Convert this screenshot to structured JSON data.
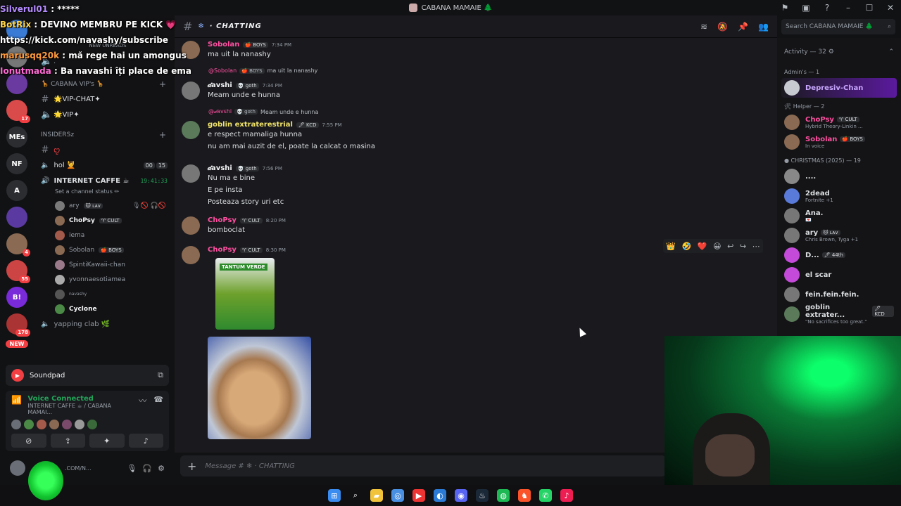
{
  "window": {
    "title": "CABANA MAMAIE 🌲",
    "controls": [
      "inbox-icon",
      "window-icon",
      "help-icon",
      "minimize-icon",
      "maximize-icon",
      "close-icon"
    ]
  },
  "overlay": {
    "lines": [
      {
        "user": "Silverul01",
        "text": " : *****"
      },
      {
        "user": "BotRix",
        "text": " : DEVINO MEMBRU PE KICK 💗"
      },
      {
        "user": "",
        "text": "https://kick.com/navashy/subscribe"
      },
      {
        "user": "marusqq20k",
        "text": " : mă rege hai un amongus"
      },
      {
        "user": "Ionutmada",
        "text": " : Ba navashi îți place de ema"
      }
    ]
  },
  "rail": {
    "servers": [
      {
        "label": "",
        "badge": ""
      },
      {
        "label": "",
        "badge": ""
      },
      {
        "label": "",
        "badge": ""
      },
      {
        "label": "",
        "badge": "17"
      },
      {
        "label": "MEs",
        "badge": ""
      },
      {
        "label": "NF",
        "badge": ""
      },
      {
        "label": "A",
        "badge": ""
      },
      {
        "label": "",
        "badge": ""
      },
      {
        "label": "",
        "badge": "4"
      },
      {
        "label": "",
        "badge": "55"
      },
      {
        "label": "B!",
        "badge": ""
      },
      {
        "label": "",
        "badge": "178"
      }
    ],
    "new_badge": "NEW"
  },
  "sidebar": {
    "new_unreads": "NEW UNREADS",
    "cat_vip": "🦒 CABANA VIP's 🦒",
    "vip_chat": "🌟VIP-CHAT✦",
    "vip_voice": "🌟VIP✦",
    "cat_insiders": "INSIDERSz",
    "insiders_text": "ꨄ",
    "hol": "hol 💆",
    "internet_caffe": {
      "name": "INTERNET CAFFE ☕",
      "timer": "19:41:33",
      "counts": [
        "00",
        "15"
      ],
      "status": "Set a channel status ✏"
    },
    "voice_users": [
      {
        "name": "ary",
        "tag": "🐱 ʟᴀᴠ",
        "highlight": false,
        "icons": "🎙🚫 🎧🚫"
      },
      {
        "name": "ChoPsy",
        "tag": "♈ CULT",
        "highlight": true,
        "icons": ""
      },
      {
        "name": "iema",
        "tag": "",
        "highlight": false,
        "icons": ""
      },
      {
        "name": "Sobolan",
        "tag": "🍎 BOYS",
        "highlight": false,
        "icons": ""
      },
      {
        "name": "SpintiKawaii-chan",
        "tag": "",
        "highlight": false,
        "icons": ""
      },
      {
        "name": "yvonnaesotiamea",
        "tag": "",
        "highlight": false,
        "icons": ""
      },
      {
        "name": "navashy",
        "tag": "",
        "highlight": false,
        "icons": ""
      },
      {
        "name": "Cyclone",
        "tag": "",
        "highlight": true,
        "icons": ""
      }
    ],
    "yapping": "yapping clab 🌿"
  },
  "soundpad": {
    "label": "Soundpad"
  },
  "voice_panel": {
    "status": "Voice Connected",
    "location": "INTERNET CAFFE ☕ / CABANA MAMAI..."
  },
  "userbar": {
    "handle": ".COM/N..."
  },
  "channel": {
    "name": "· CHATTING",
    "search_placeholder": "Search CABANA MAMAIE 🌲",
    "message_placeholder": "Message # ❄ · CHATTING"
  },
  "messages": [
    {
      "author": "Sobolan",
      "color": "#ff4fa1",
      "tag": "🍎 BOYS",
      "time": "7:34 PM",
      "lines": [
        "ma uit la nanashy"
      ],
      "reply": null
    },
    {
      "author": "𝒹avshi",
      "color": "#f2f3f5",
      "tag": "💀 goth",
      "time": "7:34 PM",
      "lines": [
        "Meam unde e hunna"
      ],
      "reply": {
        "name": "@Sobolan",
        "tag": "🍎 BOYS",
        "text": "ma uit la nanashy"
      }
    },
    {
      "author": "goblin extraterestrial",
      "color": "#f0e36a",
      "tag": "🖊 KCD",
      "time": "7:55 PM",
      "lines": [
        "e respect mamaliga hunna",
        "nu am mai auzit de el, poate la calcat o masina"
      ],
      "reply": {
        "name": "@𝒹avshi",
        "tag": "💀 goth",
        "text": "Meam unde e hunna"
      }
    },
    {
      "author": "𝒹avshi",
      "color": "#f2f3f5",
      "tag": "💀 goth",
      "time": "7:56 PM",
      "lines": [
        "Nu ma e bine",
        "E pe insta",
        "Posteaza story uri etc"
      ],
      "reply": null
    },
    {
      "author": "ChoPsy",
      "color": "#ff4fa1",
      "tag": "♈ CULT",
      "time": "8:20 PM",
      "lines": [
        "bomboclat"
      ],
      "reply": null
    },
    {
      "author": "ChoPsy",
      "color": "#ff4fa1",
      "tag": "♈ CULT",
      "time": "8:30 PM",
      "lines": [],
      "reply": null
    }
  ],
  "image_label": "TANTUM VERDE",
  "reactions": [
    "👑",
    "🤣",
    "❤️",
    "😀",
    "↩",
    "↪",
    "⋯"
  ],
  "members": {
    "activity": "Activity — 32 ⚙",
    "groups": [
      {
        "label": "Admin's — 1",
        "items": [
          {
            "name": "Depresiv-Chan",
            "sub": "",
            "color": "#c9a7ff",
            "tag": "",
            "highlight": true
          }
        ]
      },
      {
        "label": "🛠 Helper — 2",
        "items": [
          {
            "name": "ChoPsy",
            "sub": "Hybrid Theory-Linkin ...",
            "color": "#ff4fa1",
            "tag": "♈ CULT",
            "highlight": false
          },
          {
            "name": "Sobolan",
            "sub": "In voice",
            "color": "#ff4fa1",
            "tag": "🍎 BOYS",
            "highlight": false
          }
        ]
      },
      {
        "label": "● CHRISTMAS (2025) — 19",
        "items": [
          {
            "name": "....",
            "sub": "",
            "color": "#dbdee1",
            "tag": "",
            "highlight": false
          },
          {
            "name": "2dead",
            "sub": "Fortnite +1",
            "color": "#dbdee1",
            "tag": "",
            "highlight": false
          },
          {
            "name": "Ana.",
            "sub": "💌",
            "color": "#dbdee1",
            "tag": "",
            "highlight": false
          },
          {
            "name": "ary",
            "sub": "Chris Brown, Tyga +1",
            "color": "#dbdee1",
            "tag": "🐱 ʟᴀᴠ",
            "highlight": false
          },
          {
            "name": "D...",
            "sub": "",
            "color": "#dbdee1",
            "tag": "🖊 44th",
            "highlight": false
          },
          {
            "name": "el scar",
            "sub": "",
            "color": "#dbdee1",
            "tag": "",
            "highlight": false
          },
          {
            "name": "fein.fein.fein.",
            "sub": "",
            "color": "#dbdee1",
            "tag": "",
            "highlight": false
          },
          {
            "name": "goblin extrater...",
            "sub": "\"No sacrifices too great.\"",
            "color": "#dbdee1",
            "tag": "🖊 KCD",
            "highlight": false
          }
        ]
      }
    ]
  },
  "taskbar": [
    "windows-icon",
    "search-icon",
    "folder-icon",
    "chrome-icon",
    "youtube-icon",
    "edge-icon",
    "discord-icon",
    "steam-icon",
    "spotify-icon",
    "brave-icon",
    "whatsapp-icon",
    "tiktok-icon"
  ]
}
